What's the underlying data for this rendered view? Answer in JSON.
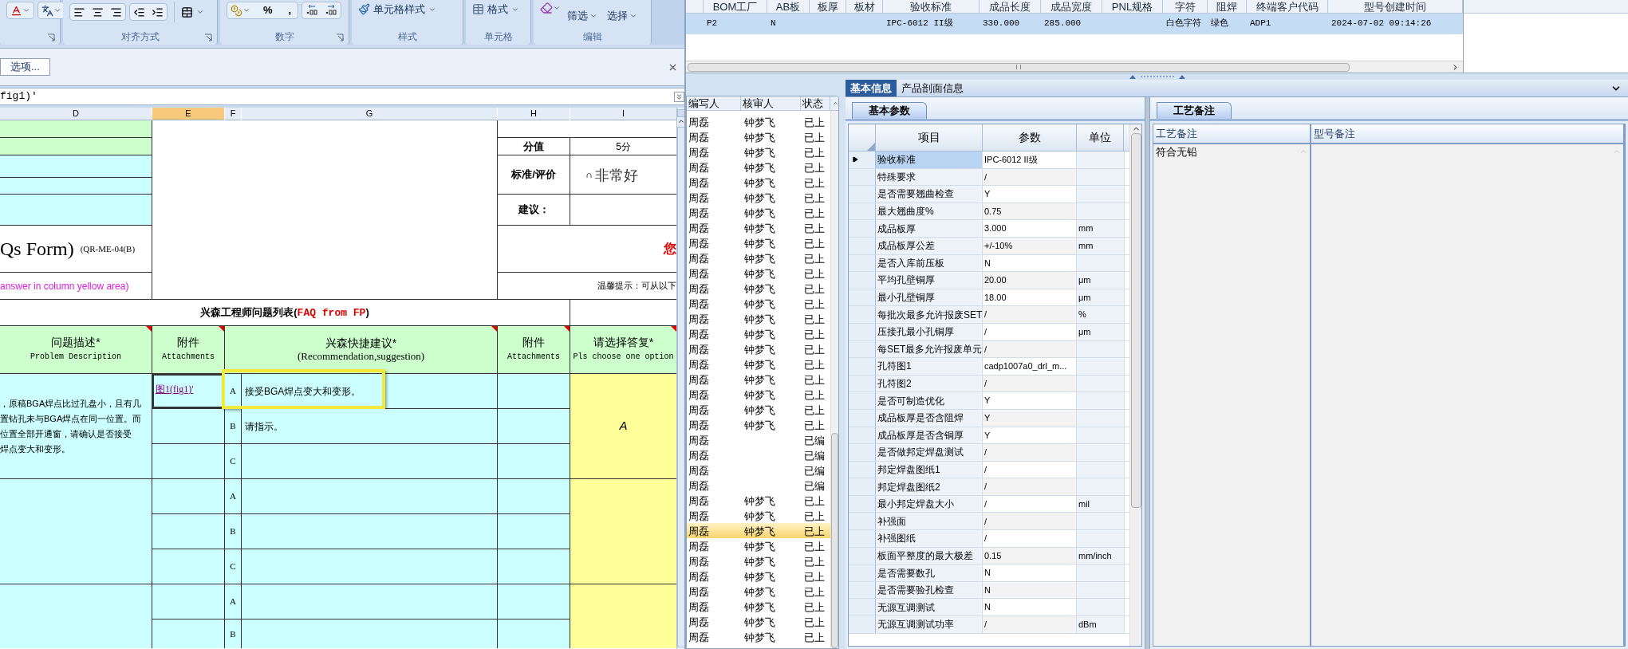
{
  "excel": {
    "ribbon": {
      "groups": [
        {
          "kind": "font"
        },
        {
          "kind": "align",
          "label": "对齐方式"
        },
        {
          "kind": "number",
          "label": "数字",
          "buttons": [
            "%",
            ","
          ]
        },
        {
          "kind": "style",
          "label": "样式",
          "buttons": [
            "单元格样式"
          ]
        },
        {
          "kind": "cells",
          "label": "单元格",
          "buttons": [
            "格式"
          ]
        },
        {
          "kind": "edit",
          "label": "编辑",
          "buttons": [
            "筛选",
            "选择"
          ]
        }
      ]
    },
    "message_bar": {
      "button": "选项..."
    },
    "formula_bar": {
      "value": "fig1)'"
    },
    "columns": [
      {
        "label": "D",
        "selected": false
      },
      {
        "label": "E",
        "selected": true
      },
      {
        "label": "F",
        "selected": false
      },
      {
        "label": "G",
        "selected": false
      },
      {
        "label": "H",
        "selected": false
      },
      {
        "label": "I",
        "selected": false
      }
    ],
    "sheet": {
      "form_title": "Qs Form)",
      "form_code": "(QR-ME-04(B)",
      "instruction": "answer in column yellow area)",
      "score_label": "分值",
      "score_value": "5分",
      "rating_label": "标准/评价",
      "rating_option": "非常好",
      "advice_label": "建议：",
      "notice": "您",
      "hint": "温馨提示：可从以下",
      "list_title": {
        "text": "兴森工程师问题列表(",
        "red": "FAQ from FP",
        "end": ")"
      },
      "headers": [
        {
          "zh": "问题描述*",
          "en": "Problem Description"
        },
        {
          "zh": "附件",
          "en": "Attachments"
        },
        {
          "zh": "兴森快捷建议*",
          "en": "(Recommendation,suggestion)"
        },
        {
          "zh": "附件",
          "en": "Attachments"
        },
        {
          "zh": "请选择答复*",
          "en": "Pls choose one option"
        }
      ],
      "issues": [
        {
          "description_lines": [
            "，原稿BGA焊点比过孔盘小，且有几",
            "置钻孔未与BGA焊点在同一位置。而",
            "位置全部开通窗，请确认是否接受",
            "焊点变大和变形。"
          ],
          "answer": "A",
          "options": [
            {
              "letter": "A",
              "text": "接受BGA焊点变大和变形。",
              "attachment": "图1(fig1)'",
              "highlighted": true
            },
            {
              "letter": "B",
              "text": "请指示。",
              "highlighted": false
            },
            {
              "letter": "C",
              "highlighted": false
            }
          ]
        },
        {
          "options": [
            {
              "letter": "A",
              "highlighted": false
            },
            {
              "letter": "B",
              "highlighted": false
            },
            {
              "letter": "C",
              "highlighted": false
            }
          ]
        },
        {
          "options": [
            {
              "letter": "A",
              "highlighted": false
            },
            {
              "letter": "B",
              "highlighted": false
            }
          ]
        }
      ]
    }
  },
  "app": {
    "top_grid": {
      "columns": [
        "BOM工厂",
        "AB板",
        "板厚",
        "板材",
        "验收标准",
        "成品长度",
        "成品宽度",
        "PNL规格",
        "字符",
        "阻焊",
        "终端客户代码",
        "型号创建时间"
      ],
      "rows": [
        {
          "selected": true,
          "cells": [
            "P2",
            "N",
            "",
            "",
            "IPC-6012 II级",
            "330.000",
            "285.000",
            "",
            "白色字符",
            "绿色",
            "ADP1",
            "2024-07-02 09:14:26"
          ]
        }
      ]
    },
    "list": {
      "columns": [
        "编写人",
        "核审人",
        "状态"
      ],
      "rows": [
        {
          "writer": "周磊",
          "reviewer": "钟梦飞",
          "status": "已上",
          "selected": false
        },
        {
          "writer": "周磊",
          "reviewer": "钟梦飞",
          "status": "已上",
          "selected": false
        },
        {
          "writer": "周磊",
          "reviewer": "钟梦飞",
          "status": "已上",
          "selected": false
        },
        {
          "writer": "周磊",
          "reviewer": "钟梦飞",
          "status": "已上",
          "selected": false
        },
        {
          "writer": "周磊",
          "reviewer": "钟梦飞",
          "status": "已上",
          "selected": false
        },
        {
          "writer": "周磊",
          "reviewer": "钟梦飞",
          "status": "已上",
          "selected": false
        },
        {
          "writer": "周磊",
          "reviewer": "钟梦飞",
          "status": "已上",
          "selected": false
        },
        {
          "writer": "周磊",
          "reviewer": "钟梦飞",
          "status": "已上",
          "selected": false
        },
        {
          "writer": "周磊",
          "reviewer": "钟梦飞",
          "status": "已上",
          "selected": false
        },
        {
          "writer": "周磊",
          "reviewer": "钟梦飞",
          "status": "已上",
          "selected": false
        },
        {
          "writer": "周磊",
          "reviewer": "钟梦飞",
          "status": "已上",
          "selected": false
        },
        {
          "writer": "周磊",
          "reviewer": "钟梦飞",
          "status": "已上",
          "selected": false
        },
        {
          "writer": "周磊",
          "reviewer": "钟梦飞",
          "status": "已上",
          "selected": false
        },
        {
          "writer": "周磊",
          "reviewer": "钟梦飞",
          "status": "已上",
          "selected": false
        },
        {
          "writer": "周磊",
          "reviewer": "钟梦飞",
          "status": "已上",
          "selected": false
        },
        {
          "writer": "周磊",
          "reviewer": "钟梦飞",
          "status": "已上",
          "selected": false
        },
        {
          "writer": "周磊",
          "reviewer": "钟梦飞",
          "status": "已上",
          "selected": false
        },
        {
          "writer": "周磊",
          "reviewer": "钟梦飞",
          "status": "已上",
          "selected": false
        },
        {
          "writer": "周磊",
          "reviewer": "钟梦飞",
          "status": "已上",
          "selected": false
        },
        {
          "writer": "周磊",
          "reviewer": "钟梦飞",
          "status": "已上",
          "selected": false
        },
        {
          "writer": "周磊",
          "reviewer": "钟梦飞",
          "status": "已上",
          "selected": false
        },
        {
          "writer": "周磊",
          "status": "已编",
          "selected": false
        },
        {
          "writer": "周磊",
          "status": "已编",
          "selected": false
        },
        {
          "writer": "周磊",
          "status": "已编",
          "selected": false
        },
        {
          "writer": "周磊",
          "status": "已编",
          "selected": false
        },
        {
          "writer": "周磊",
          "reviewer": "钟梦飞",
          "status": "已上",
          "selected": false
        },
        {
          "writer": "周磊",
          "reviewer": "钟梦飞",
          "status": "已上",
          "selected": false
        },
        {
          "writer": "周磊",
          "reviewer": "钟梦飞",
          "status": "已上",
          "selected": true
        },
        {
          "writer": "周磊",
          "reviewer": "钟梦飞",
          "status": "已上",
          "selected": false
        },
        {
          "writer": "周磊",
          "reviewer": "钟梦飞",
          "status": "已上",
          "selected": false
        },
        {
          "writer": "周磊",
          "reviewer": "钟梦飞",
          "status": "已上",
          "selected": false
        },
        {
          "writer": "周磊",
          "reviewer": "钟梦飞",
          "status": "已上",
          "selected": false
        },
        {
          "writer": "周磊",
          "reviewer": "钟梦飞",
          "status": "已上",
          "selected": false
        },
        {
          "writer": "周磊",
          "reviewer": "钟梦飞",
          "status": "已上",
          "selected": false
        },
        {
          "writer": "周磊",
          "reviewer": "钟梦飞",
          "status": "已上",
          "selected": false
        }
      ]
    },
    "detail_tabs": [
      {
        "label": "基本信息",
        "selected": true
      },
      {
        "label": "产品剖面信息",
        "selected": false
      }
    ],
    "params_panel": {
      "tab": "基本参数",
      "columns": [
        "项目",
        "参数",
        "单位"
      ],
      "rows": [
        {
          "item": "验收标准",
          "value": "IPC-6012 II级",
          "selected": true
        },
        {
          "item": "特殊要求",
          "value": "/",
          "selected": false
        },
        {
          "item": "是否需要翘曲检查",
          "value": "Y",
          "selected": false
        },
        {
          "item": "最大翘曲度%",
          "value": "0.75",
          "selected": false
        },
        {
          "item": "成品板厚",
          "value": "3.000",
          "unit": "mm",
          "selected": false
        },
        {
          "item": "成品板厚公差",
          "value": "+/-10%",
          "unit": "mm",
          "selected": false
        },
        {
          "item": "是否入库前压板",
          "value": "N",
          "selected": false
        },
        {
          "item": "平均孔壁铜厚",
          "value": "20.00",
          "unit": "μm",
          "selected": false
        },
        {
          "item": "最小孔壁铜厚",
          "value": "18.00",
          "unit": "μm",
          "selected": false
        },
        {
          "item": "每批次最多允许报废SET",
          "value": "/",
          "unit": "%",
          "selected": false
        },
        {
          "item": "压接孔最小孔铜厚",
          "value": "/",
          "unit": "μm",
          "selected": false
        },
        {
          "item": "每SET最多允许报废单元",
          "value": "/",
          "selected": false
        },
        {
          "item": "孔符图1",
          "value": "cadp1007a0_drl_m...",
          "selected": false
        },
        {
          "item": "孔符图2",
          "value": "/",
          "selected": false
        },
        {
          "item": "是否可制造优化",
          "value": "Y",
          "selected": false
        },
        {
          "item": "成品板厚是否含阻焊",
          "value": "Y",
          "selected": false
        },
        {
          "item": "成品板厚是否含铜厚",
          "value": "Y",
          "selected": false
        },
        {
          "item": "是否做邦定焊盘测试",
          "value": "/",
          "selected": false
        },
        {
          "item": "邦定焊盘图纸1",
          "value": "/",
          "selected": false
        },
        {
          "item": "邦定焊盘图纸2",
          "value": "/",
          "selected": false
        },
        {
          "item": "最小邦定焊盘大小",
          "value": "/",
          "unit": "mil",
          "selected": false
        },
        {
          "item": "补强面",
          "value": "/",
          "selected": false
        },
        {
          "item": "补强图纸",
          "value": "/",
          "selected": false
        },
        {
          "item": "板面平整度的最大极差",
          "value": "0.15",
          "unit": "mm/inch",
          "selected": false
        },
        {
          "item": "是否需要数孔",
          "value": "N",
          "selected": false
        },
        {
          "item": "是否需要验孔检查",
          "value": "N",
          "selected": false
        },
        {
          "item": "无源互调测试",
          "value": "N",
          "selected": false
        },
        {
          "item": "无源互调测试功率",
          "value": "/",
          "unit": "dBm",
          "selected": false
        }
      ]
    },
    "remarks_panel": {
      "tab": "工艺备注",
      "columns": [
        "工艺备注",
        "型号备注"
      ],
      "process_note": "符合无铅"
    }
  }
}
